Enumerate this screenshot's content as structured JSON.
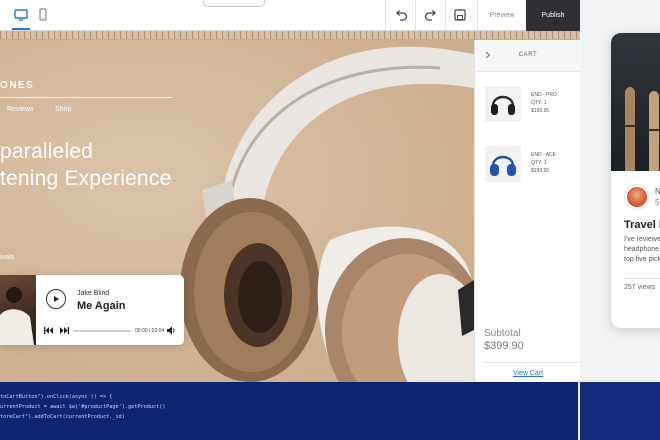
{
  "toolbar": {
    "preview_label": "Preview",
    "publish_label": "Publish",
    "icons": [
      "desktop-icon",
      "mobile-icon",
      "undo-icon",
      "redo-icon",
      "save-icon"
    ]
  },
  "site": {
    "brand": "ONES",
    "nav": [
      "Reviews",
      "Shop"
    ],
    "hero_line1": "paralleled",
    "hero_line2": "tening Experience",
    "arrivals": "ivals"
  },
  "player": {
    "artist": "Jake Blind",
    "track": "Me Again",
    "time": "00:00 / 03:04",
    "progress": 0.0
  },
  "cart": {
    "title": "CART",
    "items": [
      {
        "name": "END - PRO",
        "qty": "QTY: 1",
        "price": "$199.95"
      },
      {
        "name": "END - ACE",
        "qty": "QTY: 1",
        "price": "$199.95"
      }
    ],
    "subtotal_label": "Subtotal",
    "subtotal_value": "$399.90",
    "view_cart": "View Cart"
  },
  "code": {
    "lines": [
      "toCartButton\").onClick(async () => {",
      "urrentProduct = await $w('#productPage').getProduct()",
      "toreCart\").addToCart(currentProduct._id)"
    ]
  },
  "mobile": {
    "meta1": "N",
    "meta2": "5",
    "title": "Travel H",
    "text_lines": [
      "I've reviewe",
      "headphone",
      "top five pick"
    ],
    "views": "257 views"
  },
  "colors": {
    "accent": "#2f6fd6",
    "publish_bg": "#2d2f33",
    "hero_bg": "#d2b596",
    "code_bg": "#0d2472"
  }
}
